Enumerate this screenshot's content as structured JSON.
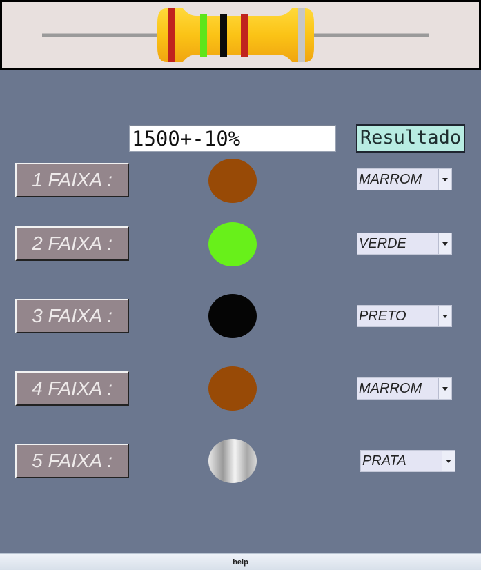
{
  "result": {
    "value": "1500+-10%",
    "button_label": "Resultado"
  },
  "bands": [
    {
      "label": "1 FAIXA :",
      "selected": "MARROM",
      "color": "#984a06"
    },
    {
      "label": "2 FAIXA :",
      "selected": "VERDE",
      "color": "#68f01a"
    },
    {
      "label": "3 FAIXA :",
      "selected": "PRETO",
      "color": "#050505"
    },
    {
      "label": "4 FAIXA :",
      "selected": "MARROM",
      "color": "#984a06"
    },
    {
      "label": "5 FAIXA :",
      "selected": "PRATA",
      "color": "#c8c8c8"
    }
  ],
  "resistor_colors": {
    "body": "#fbc316",
    "band_red": "#c0231e",
    "band_green": "#5ee51b",
    "band_black": "#0b0b0b",
    "band_silver": "#c6c6c6"
  },
  "help_label": "help"
}
